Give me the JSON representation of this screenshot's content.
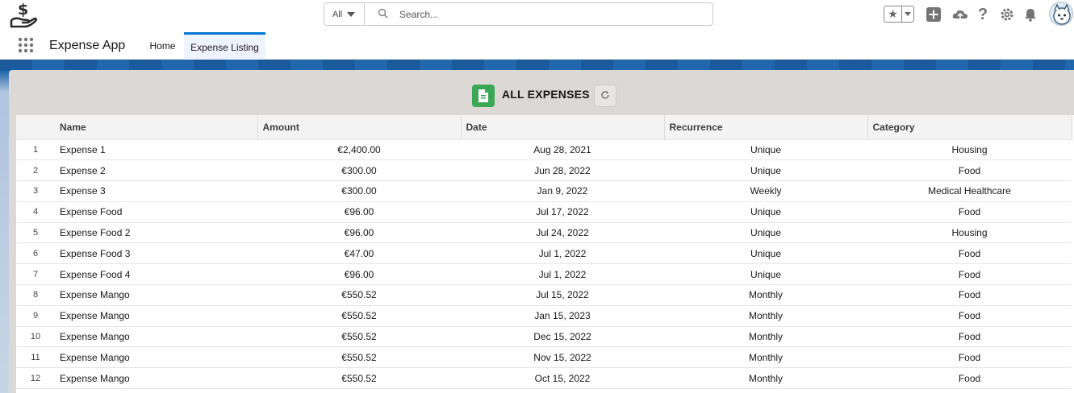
{
  "header": {
    "search_scope": "All",
    "search_placeholder": "Search..."
  },
  "nav": {
    "app_name": "Expense App",
    "tabs": [
      {
        "label": "Home"
      },
      {
        "label": "Expense Listing"
      }
    ]
  },
  "card": {
    "title": "ALL EXPENSES"
  },
  "table": {
    "columns": [
      "Name",
      "Amount",
      "Date",
      "Recurrence",
      "Category"
    ],
    "rows": [
      {
        "n": "1",
        "name": "Expense 1",
        "amount": "€2,400.00",
        "date": "Aug 28, 2021",
        "recurrence": "Unique",
        "category": "Housing"
      },
      {
        "n": "2",
        "name": "Expense 2",
        "amount": "€300.00",
        "date": "Jun 28, 2022",
        "recurrence": "Unique",
        "category": "Food"
      },
      {
        "n": "3",
        "name": "Expense 3",
        "amount": "€300.00",
        "date": "Jan 9, 2022",
        "recurrence": "Weekly",
        "category": "Medical Healthcare"
      },
      {
        "n": "4",
        "name": "Expense Food",
        "amount": "€96.00",
        "date": "Jul 17, 2022",
        "recurrence": "Unique",
        "category": "Food"
      },
      {
        "n": "5",
        "name": "Expense Food 2",
        "amount": "€96.00",
        "date": "Jul 24, 2022",
        "recurrence": "Unique",
        "category": "Housing"
      },
      {
        "n": "6",
        "name": "Expense Food 3",
        "amount": "€47.00",
        "date": "Jul 1, 2022",
        "recurrence": "Unique",
        "category": "Food"
      },
      {
        "n": "7",
        "name": "Expense Food 4",
        "amount": "€96.00",
        "date": "Jul 1, 2022",
        "recurrence": "Unique",
        "category": "Food"
      },
      {
        "n": "8",
        "name": "Expense Mango",
        "amount": "€550.52",
        "date": "Jul 15, 2022",
        "recurrence": "Monthly",
        "category": "Food"
      },
      {
        "n": "9",
        "name": "Expense Mango",
        "amount": "€550.52",
        "date": "Jan 15, 2023",
        "recurrence": "Monthly",
        "category": "Food"
      },
      {
        "n": "10",
        "name": "Expense Mango",
        "amount": "€550.52",
        "date": "Dec 15, 2022",
        "recurrence": "Monthly",
        "category": "Food"
      },
      {
        "n": "11",
        "name": "Expense Mango",
        "amount": "€550.52",
        "date": "Nov 15, 2022",
        "recurrence": "Monthly",
        "category": "Food"
      },
      {
        "n": "12",
        "name": "Expense Mango",
        "amount": "€550.52",
        "date": "Oct 15, 2022",
        "recurrence": "Monthly",
        "category": "Food"
      }
    ]
  },
  "colors": {
    "brand_blue": "#0176d3",
    "card_bg": "#dcd8d6",
    "icon_green": "#3ba755"
  },
  "icons": [
    "dollar-hand-logo-icon",
    "chevron-down-icon",
    "search-icon",
    "star-icon",
    "plus-icon",
    "cloud-icon",
    "help-icon",
    "gear-icon",
    "bell-icon",
    "app-launcher-icon",
    "expense-document-icon",
    "refresh-icon"
  ]
}
